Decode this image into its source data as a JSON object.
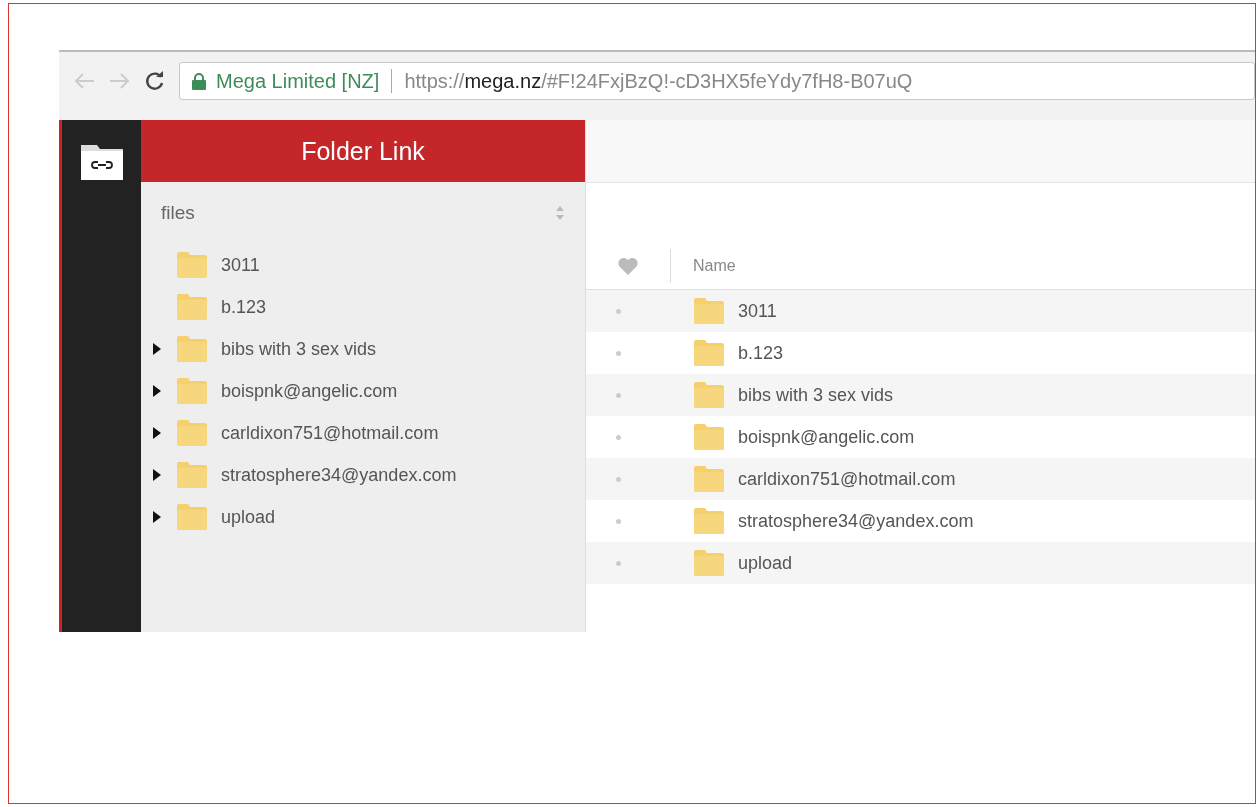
{
  "browser": {
    "site_identity": "Mega Limited [NZ]",
    "url_scheme": "https://",
    "url_host": "mega.nz",
    "url_path": "/#F!24FxjBzQ!-cD3HX5feYdy7fH8-B07uQ"
  },
  "header": {
    "title": "Folder Link"
  },
  "tree": {
    "root": "files",
    "items": [
      {
        "name": "3011",
        "expandable": false
      },
      {
        "name": "b.123",
        "expandable": false
      },
      {
        "name": "bibs with 3 sex vids",
        "expandable": true
      },
      {
        "name": "boispnk@angelic.com",
        "expandable": true
      },
      {
        "name": "carldixon751@hotmail.com",
        "expandable": true
      },
      {
        "name": "stratosphere34@yandex.com",
        "expandable": true
      },
      {
        "name": "upload",
        "expandable": true
      }
    ]
  },
  "list": {
    "columns": [
      "Name"
    ],
    "rows": [
      {
        "name": "3011"
      },
      {
        "name": "b.123"
      },
      {
        "name": "bibs with 3 sex vids"
      },
      {
        "name": "boispnk@angelic.com"
      },
      {
        "name": "carldixon751@hotmail.com"
      },
      {
        "name": "stratosphere34@yandex.com"
      },
      {
        "name": "upload"
      }
    ]
  }
}
